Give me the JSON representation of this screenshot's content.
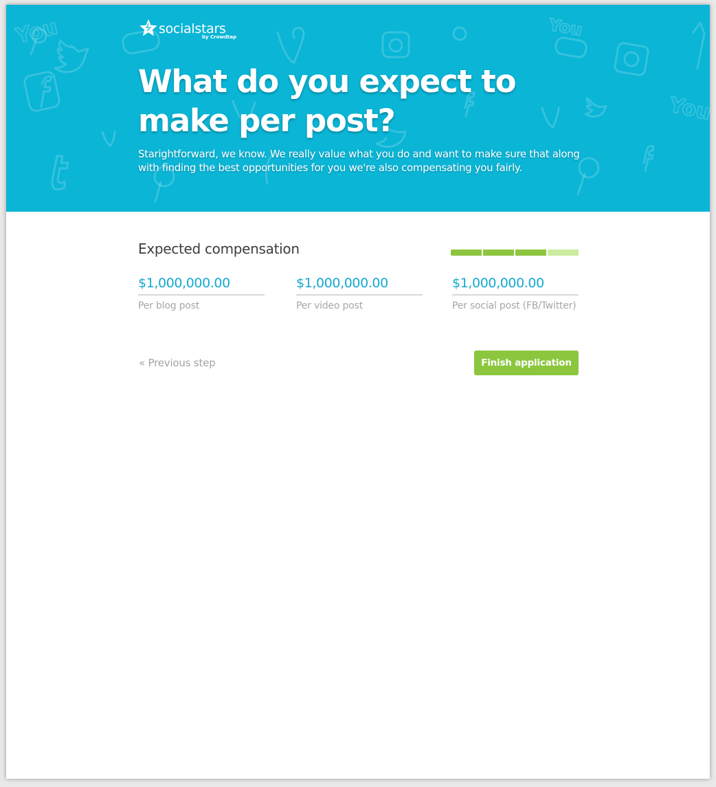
{
  "brand": {
    "name": "socialstars",
    "byline": "by Crowdtap",
    "logo_icon": "star-icon"
  },
  "hero": {
    "title": "What do you expect to make per post?",
    "subtitle": "Starightforward, we know. We really value what you do and want to make sure that along with finding the best opportunities for you we're also compensating you fairly.",
    "background_color": "#0ab5d6",
    "background_icons": [
      "facebook-icon",
      "twitter-icon",
      "youtube-icon",
      "pinterest-icon",
      "vine-icon",
      "instagram-icon",
      "tumblr-icon"
    ]
  },
  "form": {
    "section_title": "Expected compensation",
    "progress": {
      "steps_total": 4,
      "steps_completed": 3,
      "completed_color": "#8cc63f",
      "remaining_color": "#c9ec9e"
    },
    "fields": [
      {
        "value": "$1,000,000.00",
        "label": "Per blog post"
      },
      {
        "value": "$1,000,000.00",
        "label": "Per video post"
      },
      {
        "value": "$1,000,000.00",
        "label": "Per social post (FB/Twitter)"
      }
    ],
    "previous_label": "« Previous step",
    "finish_label": "Finish application",
    "accent_color": "#14a9cf"
  }
}
